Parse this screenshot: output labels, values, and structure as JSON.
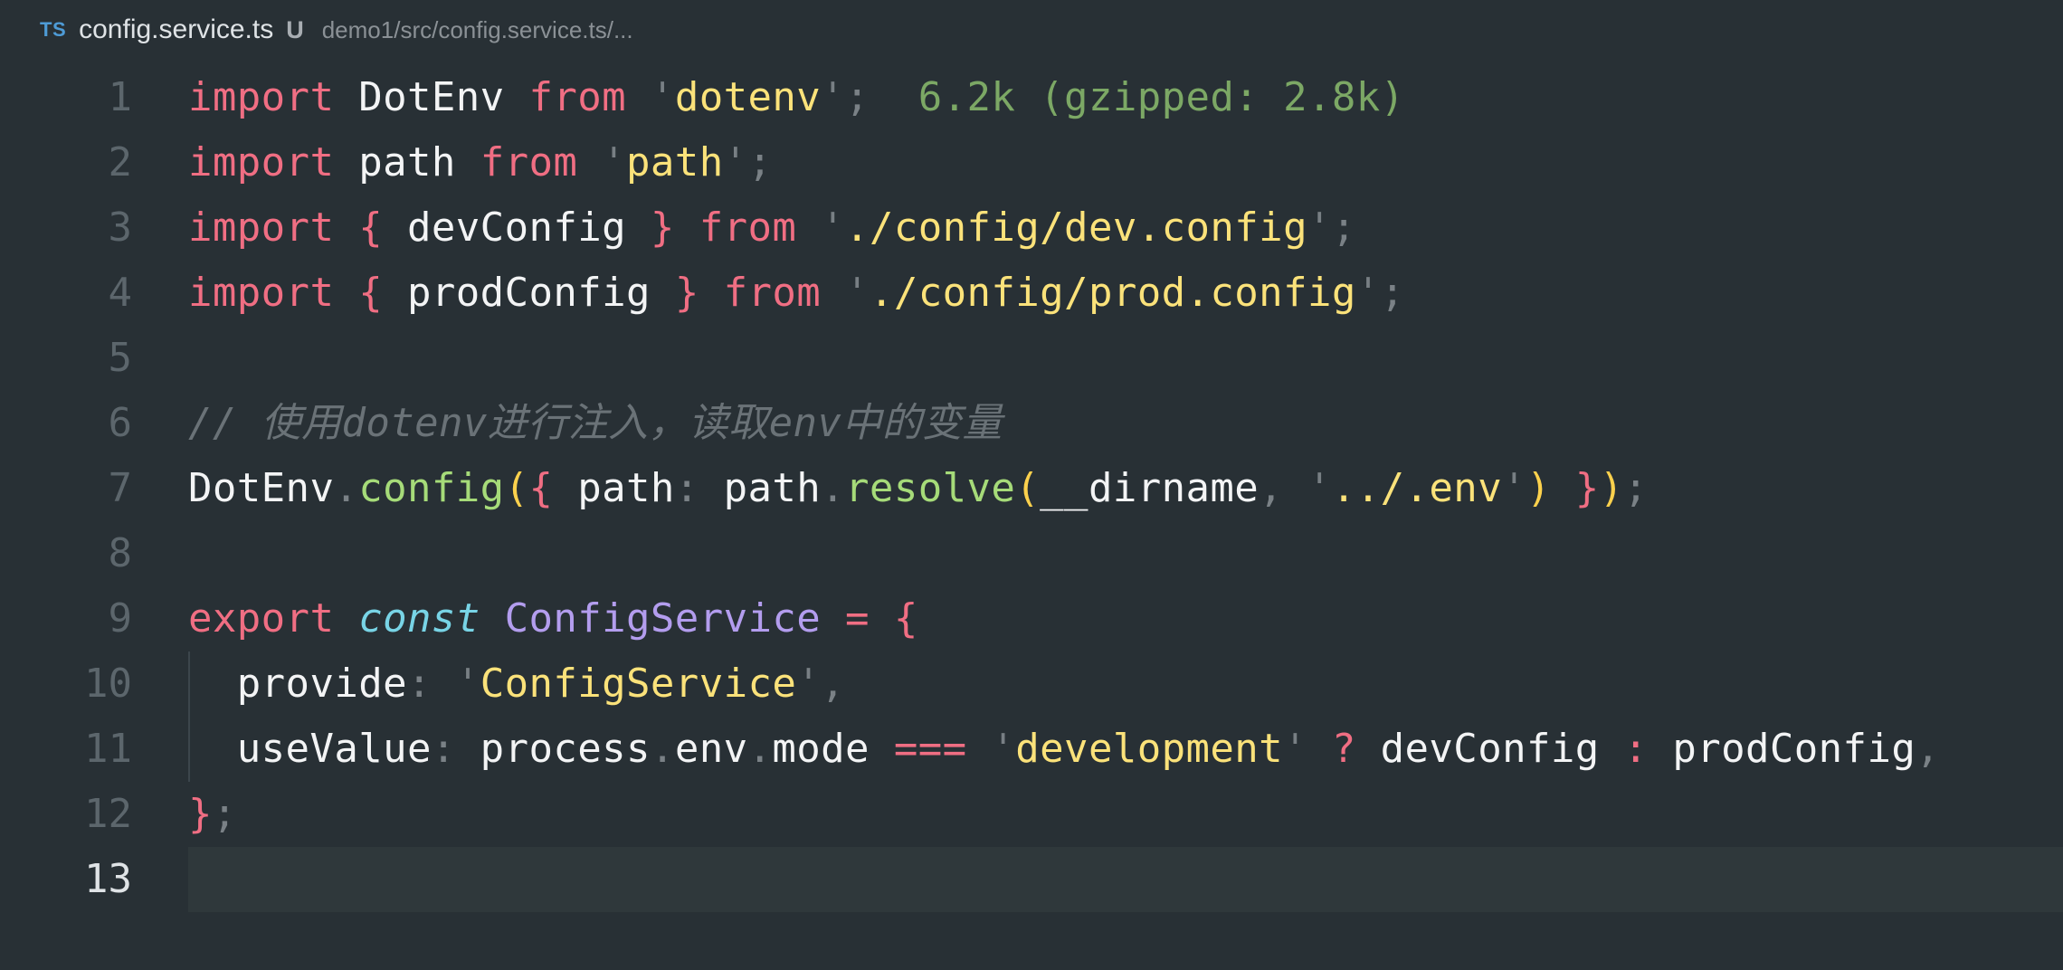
{
  "breadcrumb": {
    "lang_badge": "TS",
    "file_name": "config.service.ts",
    "git_status": "U",
    "path": "demo1/src/config.service.ts/..."
  },
  "editor": {
    "lines": [
      {
        "number": "1",
        "tokens": [
          {
            "t": "import",
            "c": "kw"
          },
          {
            "t": " DotEnv ",
            "c": ""
          },
          {
            "t": "from",
            "c": "kw"
          },
          {
            "t": " ",
            "c": ""
          },
          {
            "t": "'",
            "c": "quote"
          },
          {
            "t": "dotenv",
            "c": "str"
          },
          {
            "t": "'",
            "c": "quote"
          },
          {
            "t": ";",
            "c": "punc"
          },
          {
            "t": "  6.2k (gzipped: 2.8k)",
            "c": "hint"
          }
        ]
      },
      {
        "number": "2",
        "tokens": [
          {
            "t": "import",
            "c": "kw"
          },
          {
            "t": " path ",
            "c": ""
          },
          {
            "t": "from",
            "c": "kw"
          },
          {
            "t": " ",
            "c": ""
          },
          {
            "t": "'",
            "c": "quote"
          },
          {
            "t": "path",
            "c": "str"
          },
          {
            "t": "'",
            "c": "quote"
          },
          {
            "t": ";",
            "c": "punc"
          }
        ]
      },
      {
        "number": "3",
        "tokens": [
          {
            "t": "import",
            "c": "kw"
          },
          {
            "t": " ",
            "c": ""
          },
          {
            "t": "{",
            "c": "brace1"
          },
          {
            "t": " devConfig ",
            "c": ""
          },
          {
            "t": "}",
            "c": "brace1"
          },
          {
            "t": " ",
            "c": ""
          },
          {
            "t": "from",
            "c": "kw"
          },
          {
            "t": " ",
            "c": ""
          },
          {
            "t": "'",
            "c": "quote"
          },
          {
            "t": "./config/dev.config",
            "c": "str"
          },
          {
            "t": "'",
            "c": "quote"
          },
          {
            "t": ";",
            "c": "punc"
          }
        ]
      },
      {
        "number": "4",
        "tokens": [
          {
            "t": "import",
            "c": "kw"
          },
          {
            "t": " ",
            "c": ""
          },
          {
            "t": "{",
            "c": "brace1"
          },
          {
            "t": " prodConfig ",
            "c": ""
          },
          {
            "t": "}",
            "c": "brace1"
          },
          {
            "t": " ",
            "c": ""
          },
          {
            "t": "from",
            "c": "kw"
          },
          {
            "t": " ",
            "c": ""
          },
          {
            "t": "'",
            "c": "quote"
          },
          {
            "t": "./config/prod.config",
            "c": "str"
          },
          {
            "t": "'",
            "c": "quote"
          },
          {
            "t": ";",
            "c": "punc"
          }
        ]
      },
      {
        "number": "5",
        "tokens": []
      },
      {
        "number": "6",
        "tokens": [
          {
            "t": "// 使用dotenv进行注入，读取env中的变量",
            "c": "comment"
          }
        ]
      },
      {
        "number": "7",
        "tokens": [
          {
            "t": "DotEnv",
            "c": ""
          },
          {
            "t": ".",
            "c": "punc"
          },
          {
            "t": "config",
            "c": "fn"
          },
          {
            "t": "(",
            "c": "brace2"
          },
          {
            "t": "{",
            "c": "brace1"
          },
          {
            "t": " path",
            "c": ""
          },
          {
            "t": ":",
            "c": "punc"
          },
          {
            "t": " path",
            "c": ""
          },
          {
            "t": ".",
            "c": "punc"
          },
          {
            "t": "resolve",
            "c": "fn"
          },
          {
            "t": "(",
            "c": "brace2"
          },
          {
            "t": "__dirname",
            "c": ""
          },
          {
            "t": ",",
            "c": "punc"
          },
          {
            "t": " ",
            "c": ""
          },
          {
            "t": "'",
            "c": "quote"
          },
          {
            "t": "../.env",
            "c": "str"
          },
          {
            "t": "'",
            "c": "quote"
          },
          {
            "t": ")",
            "c": "brace2"
          },
          {
            "t": " ",
            "c": ""
          },
          {
            "t": "}",
            "c": "brace1"
          },
          {
            "t": ")",
            "c": "brace2"
          },
          {
            "t": ";",
            "c": "punc"
          }
        ]
      },
      {
        "number": "8",
        "tokens": []
      },
      {
        "number": "9",
        "tokens": [
          {
            "t": "export",
            "c": "kw"
          },
          {
            "t": " ",
            "c": ""
          },
          {
            "t": "const",
            "c": "italic-kw"
          },
          {
            "t": " ",
            "c": ""
          },
          {
            "t": "ConfigService",
            "c": "cls"
          },
          {
            "t": " ",
            "c": ""
          },
          {
            "t": "=",
            "c": "op"
          },
          {
            "t": " ",
            "c": ""
          },
          {
            "t": "{",
            "c": "brace1"
          }
        ]
      },
      {
        "number": "10",
        "indent": true,
        "tokens": [
          {
            "t": "  provide",
            "c": ""
          },
          {
            "t": ":",
            "c": "punc"
          },
          {
            "t": " ",
            "c": ""
          },
          {
            "t": "'",
            "c": "quote"
          },
          {
            "t": "ConfigService",
            "c": "str"
          },
          {
            "t": "'",
            "c": "quote"
          },
          {
            "t": ",",
            "c": "punc"
          }
        ]
      },
      {
        "number": "11",
        "indent": true,
        "tokens": [
          {
            "t": "  useValue",
            "c": ""
          },
          {
            "t": ":",
            "c": "punc"
          },
          {
            "t": " process",
            "c": ""
          },
          {
            "t": ".",
            "c": "punc"
          },
          {
            "t": "env",
            "c": ""
          },
          {
            "t": ".",
            "c": "punc"
          },
          {
            "t": "mode ",
            "c": ""
          },
          {
            "t": "===",
            "c": "op"
          },
          {
            "t": " ",
            "c": ""
          },
          {
            "t": "'",
            "c": "quote"
          },
          {
            "t": "development",
            "c": "str"
          },
          {
            "t": "'",
            "c": "quote"
          },
          {
            "t": " ",
            "c": ""
          },
          {
            "t": "?",
            "c": "op"
          },
          {
            "t": " devConfig ",
            "c": ""
          },
          {
            "t": ":",
            "c": "op"
          },
          {
            "t": " prodConfig",
            "c": ""
          },
          {
            "t": ",",
            "c": "punc"
          }
        ]
      },
      {
        "number": "12",
        "tokens": [
          {
            "t": "}",
            "c": "brace1"
          },
          {
            "t": ";",
            "c": "punc"
          }
        ]
      },
      {
        "number": "13",
        "current": true,
        "tokens": []
      }
    ]
  },
  "colors": {
    "background": "#283035",
    "keyword": "#f06e83",
    "string": "#fbe27a",
    "function": "#a6db79",
    "class": "#b39dee",
    "const_keyword": "#78d4e6",
    "bracket": "#fcd14d",
    "comment": "#6a7277",
    "import_cost_hint": "#7ca865",
    "current_line": "#2f383b"
  }
}
